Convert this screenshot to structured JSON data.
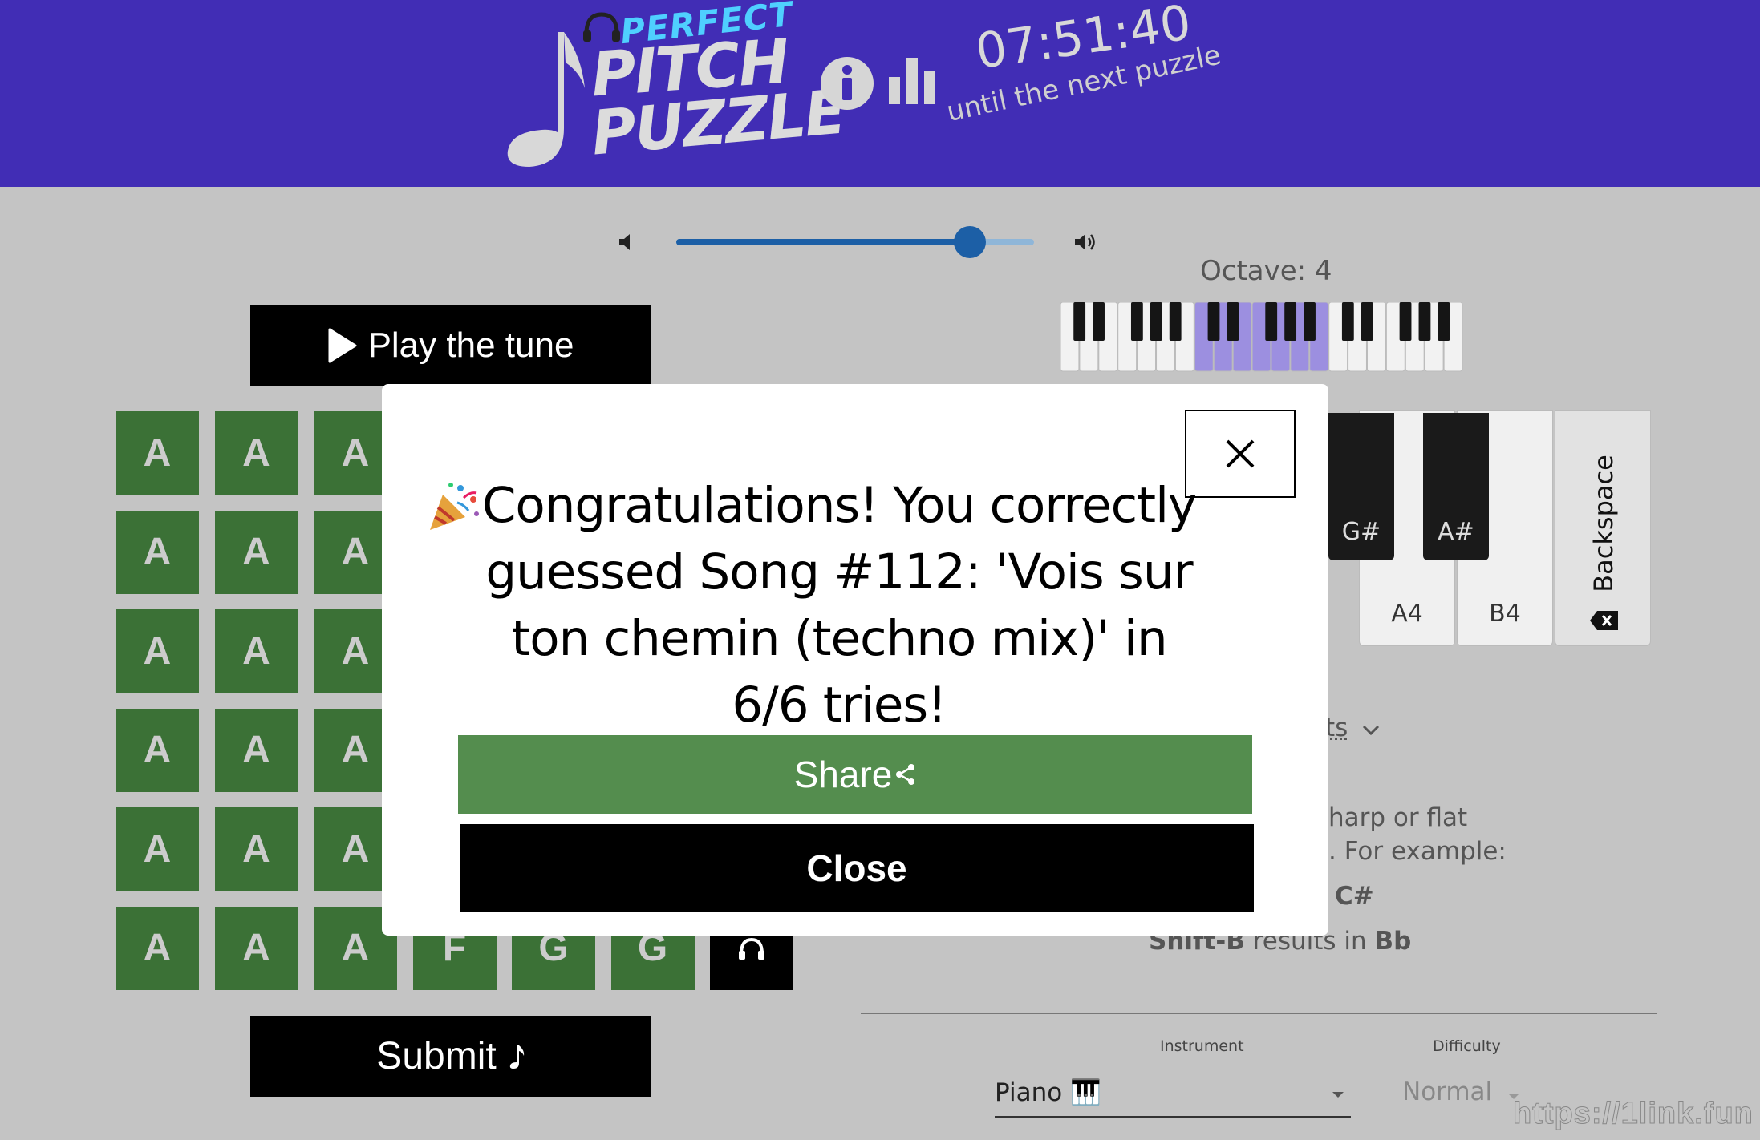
{
  "header": {
    "logo": {
      "line1": "PERFECT",
      "line2": "PITCH",
      "line3": "PUZZLE"
    },
    "info_icon": "info-icon",
    "stats_icon": "bar-chart-icon",
    "timer": "07:51:40",
    "timer_caption": "until the next puzzle"
  },
  "volume": {
    "level": 0.82,
    "min_icon": "volume-low-icon",
    "max_icon": "volume-high-icon"
  },
  "keyboard": {
    "octave_label": "Octave: 4",
    "visible_keys": [
      {
        "label": "G#",
        "kind": "black"
      },
      {
        "label": "A#",
        "kind": "black"
      },
      {
        "label": "A4",
        "kind": "white"
      },
      {
        "label": "B4",
        "kind": "white"
      }
    ],
    "backspace_label": "Backspace"
  },
  "play_button": {
    "label": "Play the tune"
  },
  "guesses": {
    "rows": [
      [
        "A",
        "A",
        "A"
      ],
      [
        "A",
        "A",
        "A"
      ],
      [
        "A",
        "A",
        "A"
      ],
      [
        "A",
        "A",
        "A"
      ],
      [
        "A",
        "A",
        "A"
      ],
      [
        "A",
        "A",
        "A",
        "F",
        "G",
        "G"
      ]
    ],
    "listen_icon": "headphones-icon"
  },
  "submit_button": {
    "label": "Submit"
  },
  "help": {
    "toggle_label": "ts",
    "fragment1": "harp or flat",
    "fragment2": ". For example:",
    "fragment3": "C#",
    "line_b_key": "Shift-B",
    "line_b_mid": " results in ",
    "line_b_result": "Bb"
  },
  "settings": {
    "instrument_label": "Instrument",
    "instrument_value": "Piano 🎹",
    "difficulty_label": "Difficulty",
    "difficulty_value": "Normal"
  },
  "modal": {
    "emoji": "🎉",
    "message": "Congratulations! You correctly guessed Song #112: 'Vois sur ton chemin (techno mix)' in 6/6 tries!",
    "share_label": "Share",
    "close_label": "Close"
  },
  "watermark": "https://1link.fun",
  "colors": {
    "header": "#412db5",
    "tile": "#3b7136",
    "share": "#548d4e",
    "slider": "#1c5fa6",
    "highlight_keys": "#9c8fe0"
  }
}
